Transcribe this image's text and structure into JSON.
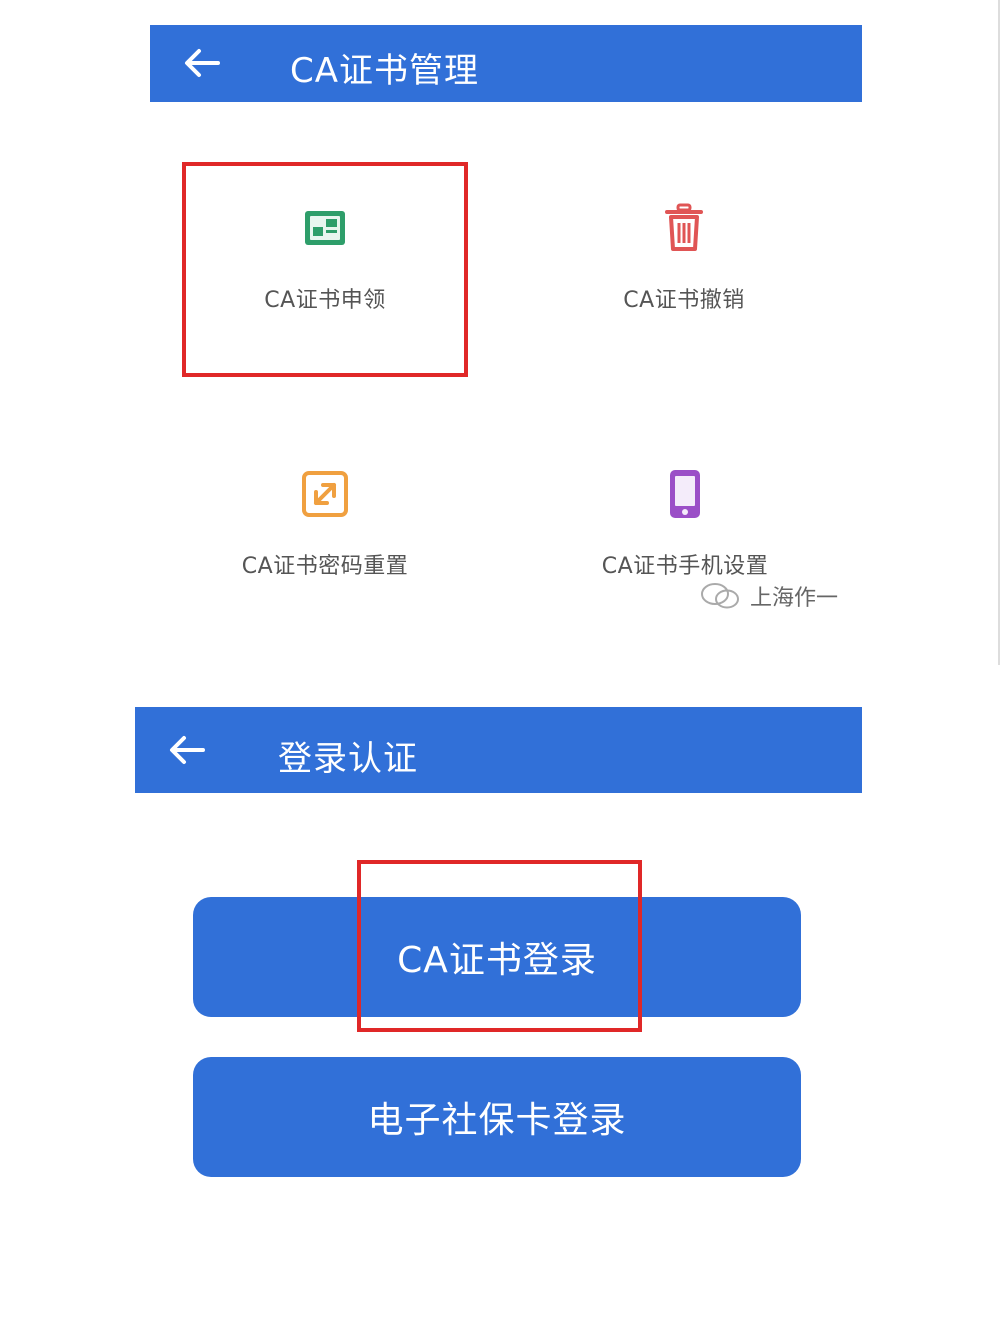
{
  "colors": {
    "primary": "#3170d8",
    "highlight": "#e02828",
    "apply_icon": "#2e9e6a",
    "revoke_icon": "#e05555",
    "reset_icon": "#f0a040",
    "phone_icon": "#9b4fc7"
  },
  "ca_management": {
    "back_icon": "arrow-left-icon",
    "title": "CA证书管理",
    "items": [
      {
        "label": "CA证书申领",
        "icon": "certificate-icon"
      },
      {
        "label": "CA证书撤销",
        "icon": "trash-icon"
      },
      {
        "label": "CA证书密码重置",
        "icon": "password-reset-icon"
      },
      {
        "label": "CA证书手机设置",
        "icon": "phone-icon"
      }
    ]
  },
  "watermark": {
    "author": "上海作一",
    "icon": "wechat-icon"
  },
  "login_auth": {
    "back_icon": "arrow-left-icon",
    "title": "登录认证",
    "ca_login_label": "CA证书登录",
    "social_card_login_label": "电子社保卡登录"
  }
}
